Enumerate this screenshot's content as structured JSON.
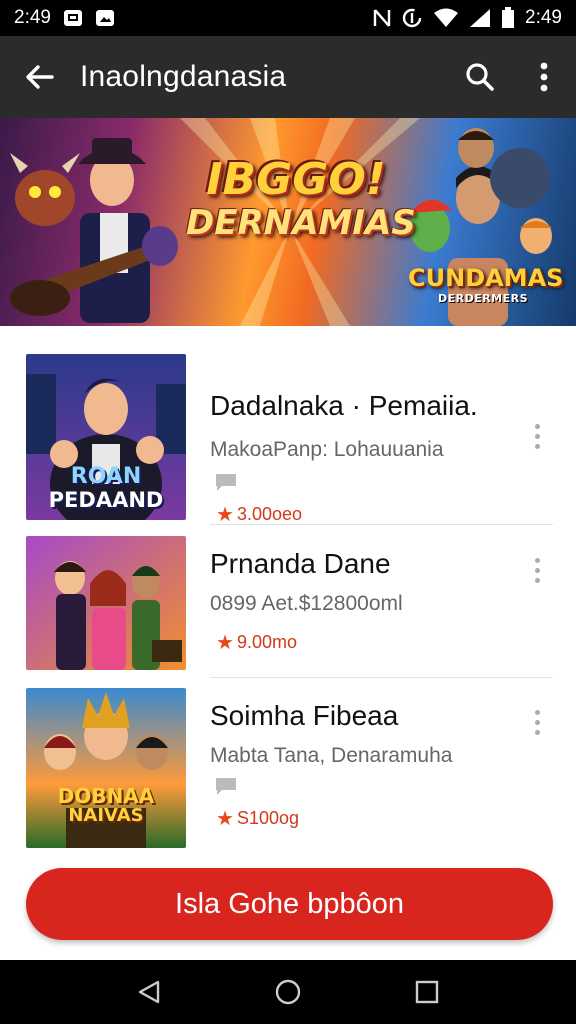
{
  "status_bar": {
    "time_left": "2:49",
    "time_right": "2:49",
    "icons_left": [
      "notification-icon",
      "photo-icon"
    ],
    "icons_right": [
      "nfc-icon",
      "data-saver-icon",
      "wifi-icon",
      "signal-icon",
      "battery-icon"
    ]
  },
  "app_bar": {
    "title": "Inaolngdanasia",
    "icons": [
      "back-arrow-icon",
      "search-icon",
      "more-vert-icon"
    ],
    "background": "#2b2b2b"
  },
  "banner": {
    "title_line1": "IBGGO!",
    "title_line2": "DERNAMIAS",
    "badge_line1": "CUNDAMAS",
    "badge_line2": "DERDERMERS"
  },
  "list": {
    "items": [
      {
        "title": "Dadalnaka · Pemaiia.",
        "subtitle": "MakoaPanp: Lohauuania",
        "rating": "3.00oeo",
        "thumb_label_line1": "ROAN",
        "thumb_label_line2": "PEDAAND",
        "has_chat_icon": true
      },
      {
        "title": "Prnanda Dane",
        "subtitle": "0899  Aet.$12800oml",
        "rating": "9.00mo",
        "thumb_label_line1": "",
        "thumb_label_line2": "",
        "has_chat_icon": false
      },
      {
        "title": "Soimha Fibeaa",
        "subtitle": "Mabta Tana, Denaramuha",
        "rating": "S100og",
        "thumb_label_line1": "DOBNAA",
        "thumb_label_line2": "NAIVAS",
        "has_chat_icon": true
      }
    ]
  },
  "primary_button": {
    "label": "Isla Gohe bpbôon",
    "color": "#d8261f"
  },
  "nav_bar": {
    "icons": [
      "back-triangle-icon",
      "home-circle-icon",
      "recents-square-icon"
    ]
  },
  "colors": {
    "accent": "#d8261f",
    "rating": "#e64a19",
    "status_bar": "#000000"
  }
}
